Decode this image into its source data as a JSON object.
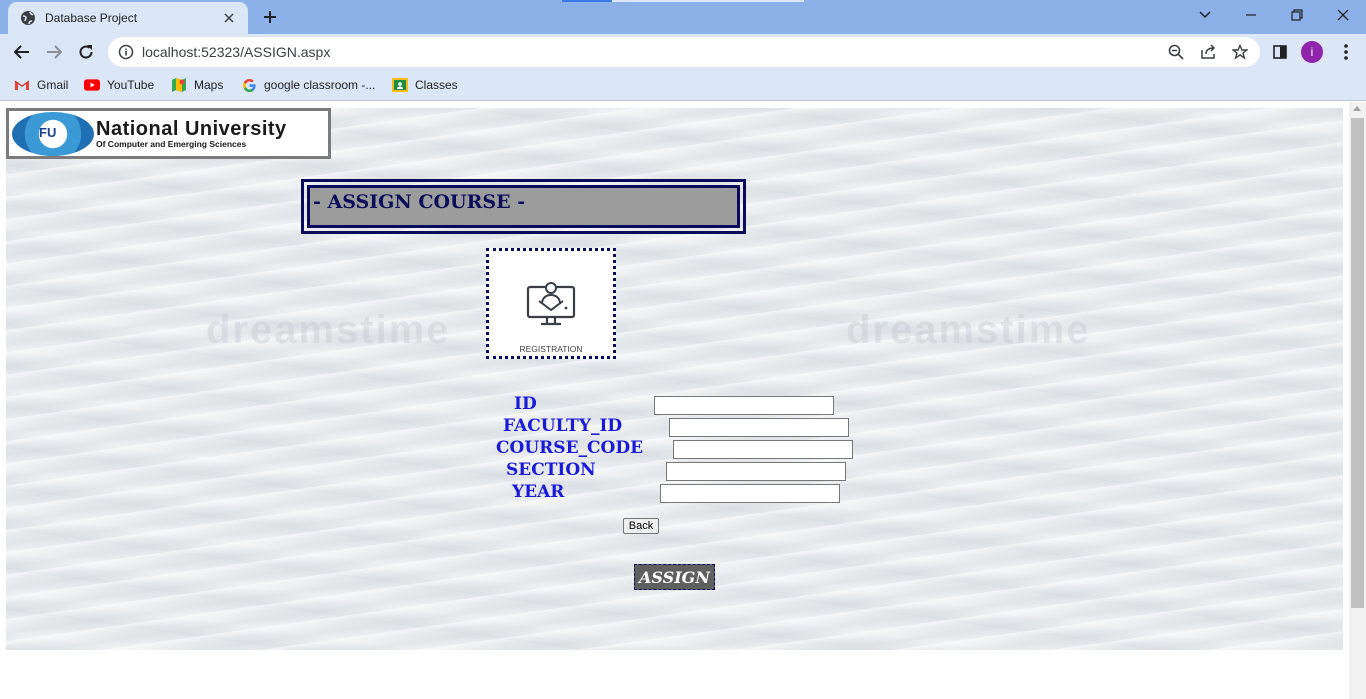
{
  "browser": {
    "tab_title": "Database Project",
    "url": "localhost:52323/ASSIGN.aspx",
    "avatar_letter": "i",
    "bookmarks": [
      {
        "label": "Gmail",
        "icon": "gmail-icon"
      },
      {
        "label": "YouTube",
        "icon": "youtube-icon"
      },
      {
        "label": "Maps",
        "icon": "maps-icon"
      },
      {
        "label": "google classroom -...",
        "icon": "google-icon"
      },
      {
        "label": "Classes",
        "icon": "classroom-icon"
      }
    ]
  },
  "page": {
    "logo": {
      "title": "National University",
      "subtitle": "Of Computer and Emerging Sciences",
      "seal_text": "FU"
    },
    "heading": "- ASSIGN COURSE -",
    "registration_caption": "REGISTRATION",
    "watermark": "dreamstime",
    "form": {
      "fields": [
        {
          "label": "ID",
          "value": ""
        },
        {
          "label": "FACULTY_ID",
          "value": ""
        },
        {
          "label": "COURSE_CODE",
          "value": ""
        },
        {
          "label": "SECTION",
          "value": ""
        },
        {
          "label": "YEAR",
          "value": ""
        }
      ],
      "back_label": "Back",
      "assign_label": "ASSIGN"
    }
  },
  "colors": {
    "heading_border": "#0b0b5b",
    "label_color": "#1a1ad8",
    "assign_bg": "#5f5f5f",
    "tab_strip": "#8cb0e8",
    "toolbar": "#dbe6f7"
  }
}
